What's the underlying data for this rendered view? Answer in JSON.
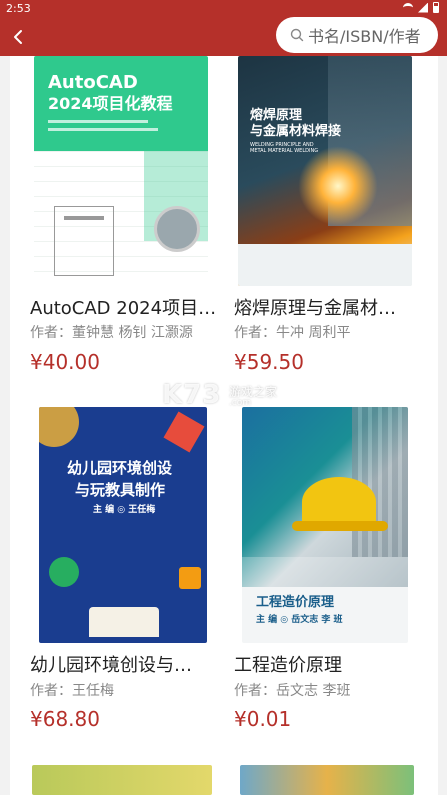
{
  "status_bar": {
    "time": "2:53"
  },
  "search": {
    "placeholder": "书名/ISBN/作者"
  },
  "books": [
    {
      "title": "AutoCAD 2024项目…",
      "author": "作者：董钟慧 杨钊 江灏源",
      "price": "¥40.00",
      "cover_title_1": "AutoCAD",
      "cover_title_2": "2024项目化教程"
    },
    {
      "title": "熔焊原理与金属材…",
      "author": "作者：牛冲 周利平",
      "price": "¥59.50",
      "cover_title_1": "熔焊原理",
      "cover_title_2": "与金属材料焊接",
      "cover_en": "WELDING PRINCIPLE AND METAL MATERIAL WELDING"
    },
    {
      "title": "幼儿园环境创设与…",
      "author": "作者：王任梅",
      "price": "¥68.80",
      "cover_title_1": "幼儿园环境创设",
      "cover_title_2": "与玩教具制作",
      "cover_editor": "主 编 ◎ 王任梅"
    },
    {
      "title": "工程造价原理",
      "author": "作者：岳文志 李班",
      "price": "¥0.01",
      "cover_title_1": "工程造价原理",
      "cover_editor": "主 编 ◎ 岳文志  李 班"
    }
  ],
  "watermark": {
    "logo": "K73",
    "text": "游戏之家",
    "url": ".com"
  },
  "colors": {
    "header": "#b5302a",
    "price": "#b5302a"
  },
  "icons": {
    "back": "back-arrow-icon",
    "search": "search-icon"
  }
}
